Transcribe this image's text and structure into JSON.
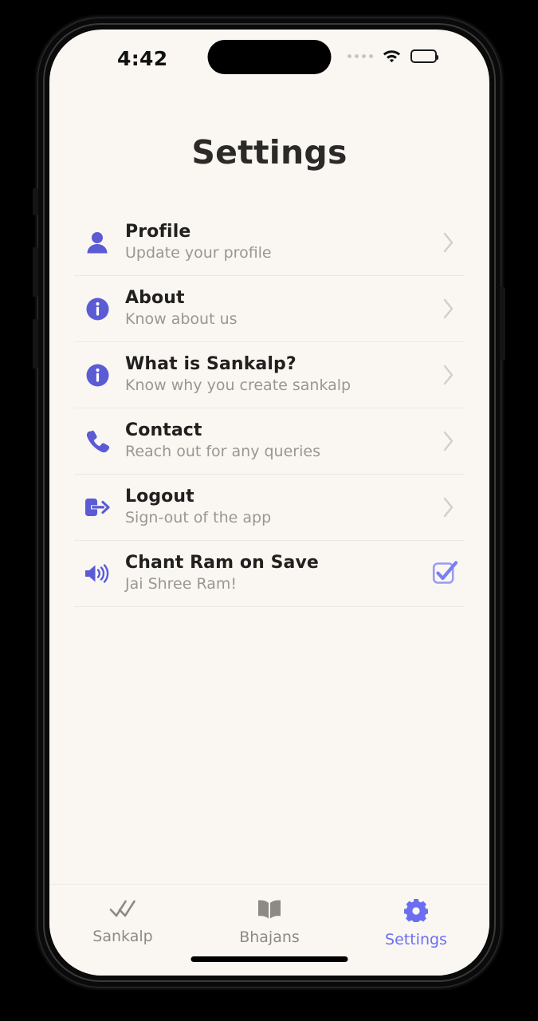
{
  "status_bar": {
    "time": "4:42",
    "cellular_icon": "cellular-dots-icon",
    "wifi_icon": "wifi-icon",
    "battery_icon": "battery-icon"
  },
  "header": {
    "title": "Settings"
  },
  "colors": {
    "accent": "#5B5BD6",
    "accent_light": "#9a9cf5",
    "tab_active": "#6c6ef0",
    "screen_bg": "#FAF7F2",
    "title_text": "#22201e",
    "sub_text": "#9a9691",
    "divider": "#EDE8E1"
  },
  "settings_items": [
    {
      "title": "Profile",
      "subtitle": "Update your profile",
      "icon": "person-icon",
      "trailing": "chevron-right-icon"
    },
    {
      "title": "About",
      "subtitle": "Know about us",
      "icon": "info-circle-icon",
      "trailing": "chevron-right-icon"
    },
    {
      "title": "What is Sankalp?",
      "subtitle": "Know why you create sankalp",
      "icon": "info-circle-icon",
      "trailing": "chevron-right-icon"
    },
    {
      "title": "Contact",
      "subtitle": "Reach out for any queries",
      "icon": "phone-icon",
      "trailing": "chevron-right-icon"
    },
    {
      "title": "Logout",
      "subtitle": "Sign-out of the app",
      "icon": "logout-icon",
      "trailing": "chevron-right-icon"
    },
    {
      "title": "Chant Ram on Save",
      "subtitle": "Jai Shree Ram!",
      "icon": "speaker-volume-icon",
      "trailing": "checkbox-checked-icon",
      "checked": true
    }
  ],
  "tab_bar": {
    "items": [
      {
        "label": "Sankalp",
        "icon": "double-check-icon",
        "active": false
      },
      {
        "label": "Bhajans",
        "icon": "open-book-icon",
        "active": false
      },
      {
        "label": "Settings",
        "icon": "gear-icon",
        "active": true
      }
    ]
  }
}
